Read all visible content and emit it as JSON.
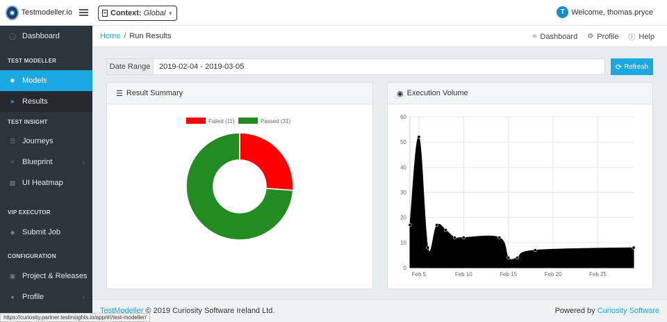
{
  "header": {
    "brand": "Testmodeller.io",
    "context_label": "Context:",
    "context_value": "Global",
    "avatar_letter": "T",
    "welcome": "Welcome, thomas.pryce"
  },
  "sidebar": {
    "items": [
      {
        "label": "Dashboard",
        "icon": "dashboard-icon"
      },
      {
        "header": "TEST MODELLER"
      },
      {
        "label": "Models",
        "icon": "models-icon",
        "active": true
      },
      {
        "label": "Results",
        "icon": "rocket-icon"
      },
      {
        "header": "TEST INSIGHT"
      },
      {
        "label": "Journeys",
        "icon": "layers-icon"
      },
      {
        "label": "Blueprint",
        "icon": "share-icon"
      },
      {
        "label": "UI Heatmap",
        "icon": "map-icon"
      },
      {
        "header": "VIP EXECUTOR"
      },
      {
        "label": "Submit Job",
        "icon": "diamond-icon"
      },
      {
        "header": "CONFIGURATION"
      },
      {
        "label": "Project & Releases",
        "icon": "folder-icon"
      },
      {
        "label": "Profile",
        "icon": "user-icon"
      }
    ]
  },
  "breadcrumb": {
    "home": "Home",
    "separator": "/",
    "current": "Run Results"
  },
  "topnav": {
    "dashboard": "Dashboard",
    "profile": "Profile",
    "help": "Help"
  },
  "filters": {
    "date_range_label": "Date Range",
    "date_range_value": "2019-02-04 - 2019-03-05",
    "refresh_label": "Refresh"
  },
  "result_summary": {
    "title": "Result Summary"
  },
  "execution_volume": {
    "title": "Execution Volume"
  },
  "chart_data": [
    {
      "type": "pie",
      "variant": "doughnut",
      "labels": [
        "Failed (11)",
        "Passed (31)"
      ],
      "values": [
        11,
        31
      ],
      "colors": [
        "#ff0000",
        "#228b22"
      ],
      "legend": "top"
    },
    {
      "type": "area",
      "x": [
        "Feb 4",
        "Feb 5",
        "Feb 6",
        "Feb 7",
        "Feb 8",
        "Feb 9",
        "Feb 10",
        "Feb 14",
        "Feb 15",
        "Feb 16",
        "Feb 18",
        "Mar 1"
      ],
      "values": [
        17,
        52,
        8,
        17,
        15,
        12,
        12,
        12,
        4,
        4,
        7,
        8
      ],
      "color": "#000000",
      "xticks": [
        "Feb 5",
        "Feb 10",
        "Feb 15",
        "Feb 20",
        "Feb 25"
      ],
      "yticks": [
        "0",
        "10",
        "20",
        "30",
        "40",
        "50",
        "60"
      ],
      "ylim": [
        0,
        60
      ],
      "grid": true
    }
  ],
  "footer": {
    "brand_link": "TestModeller",
    "copyright": "© 2019 Curiosity Software Ireland Ltd.",
    "powered_by": "Powered by",
    "powered_link": "Curiosity Software"
  },
  "status_url": "https://curiosity.partner.testinsights.io/app/#!/test-modeller/"
}
